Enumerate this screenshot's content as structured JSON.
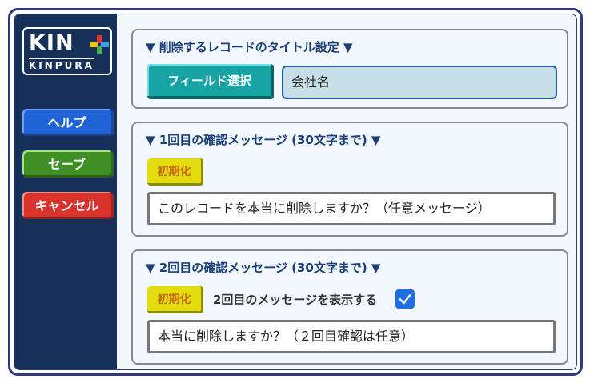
{
  "logo": {
    "big_text": "KIN",
    "small_text": "KINPURA"
  },
  "sidebar": {
    "help_label": "ヘルプ",
    "save_label": "セーブ",
    "cancel_label": "キャンセル"
  },
  "section1": {
    "title": "▼ 削除するレコードのタイトル設定 ▼",
    "field_button_label": "フィールド選択",
    "field_value": "会社名"
  },
  "section2": {
    "title": "▼ 1回目の確認メッセージ (30文字まで) ▼",
    "reset_label": "初期化",
    "message": "このレコードを本当に削除しますか？（任意メッセージ）"
  },
  "section3": {
    "title": "▼ 2回目の確認メッセージ (30文字まで) ▼",
    "reset_label": "初期化",
    "show_label": "2回目のメッセージを表示する",
    "show_checked": true,
    "message": "本当に削除しますか？（２回目確認は任意）"
  },
  "colors": {
    "sidebar": "#16305a",
    "help": "#1f63d6",
    "save": "#3f8f25",
    "cancel": "#d8322a",
    "field_button": "#17a3a3",
    "reset": "#e3dd10",
    "title": "#1a3f7a"
  }
}
